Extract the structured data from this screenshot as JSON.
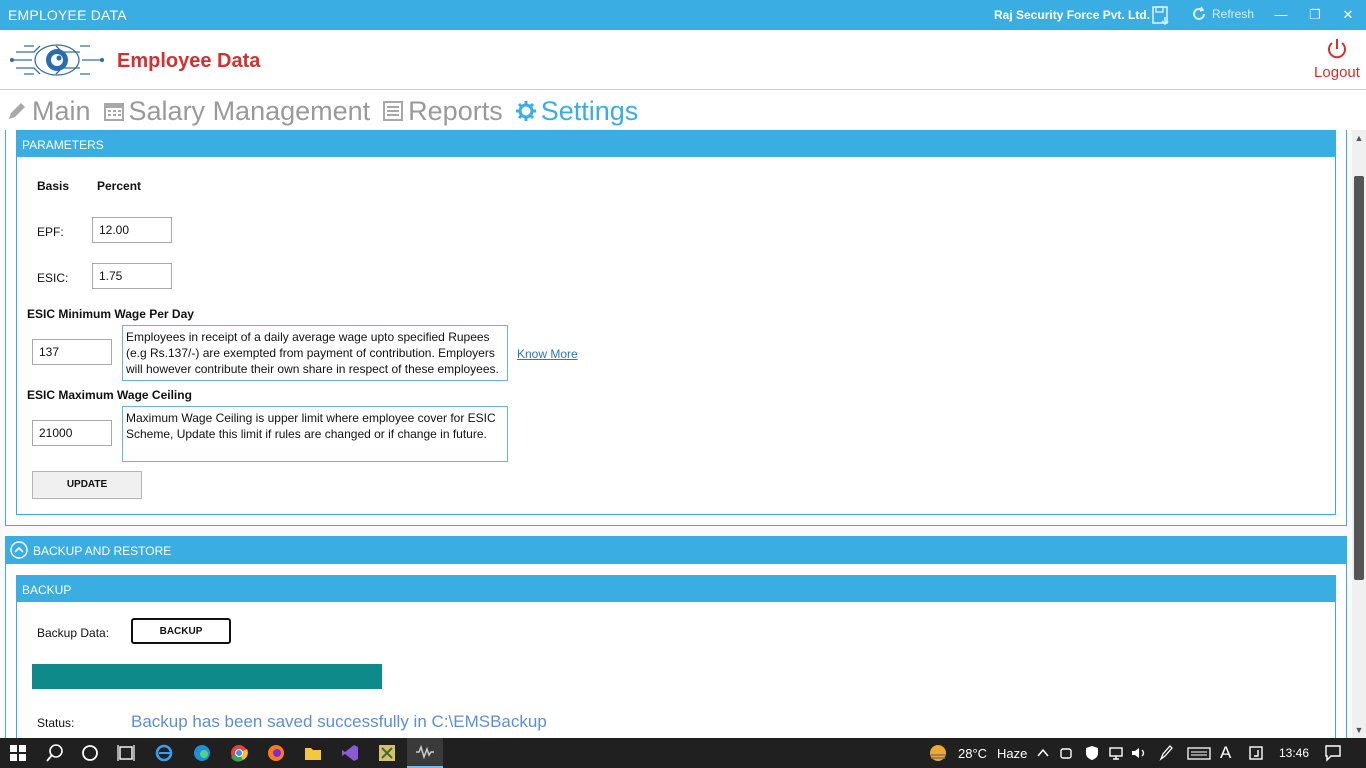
{
  "window": {
    "title": "EMPLOYEE DATA",
    "company": "Raj Security Force Pvt. Ltd.",
    "refresh_label": "Refresh",
    "minimize": "—",
    "restore": "❐",
    "close": "✕"
  },
  "header": {
    "title": "Employee Data",
    "logout_label": "Logout"
  },
  "tabs": [
    {
      "label": "Main",
      "icon": "pencil-icon",
      "active": false
    },
    {
      "label": "Salary Management",
      "icon": "calendar-icon",
      "active": false
    },
    {
      "label": "Reports",
      "icon": "list-icon",
      "active": false
    },
    {
      "label": "Settings",
      "icon": "gear-icon",
      "active": true
    }
  ],
  "parameters": {
    "title": "PARAMETERS",
    "basis_header": "Basis",
    "percent_header": "Percent",
    "epf_label": "EPF:",
    "epf_value": "12.00",
    "esic_label": "ESIC:",
    "esic_value": "1.75",
    "esic_min_title": "ESIC Minimum Wage Per Day",
    "esic_min_value": "137",
    "esic_min_note": "Employees in receipt of a daily average wage upto specified Rupees (e.g Rs.137/-) are exempted from payment of contribution. Employers will however contribute their own share in respect of these employees.",
    "know_more": "Know More",
    "esic_max_title": "ESIC Maximum Wage Ceiling",
    "esic_max_value": "21000",
    "esic_max_note": "Maximum Wage Ceiling is upper limit where employee cover for ESIC Scheme, Update this limit if rules are changed or if change in future.",
    "update_label": "UPDATE"
  },
  "backup_restore": {
    "title": "BACKUP AND RESTORE",
    "backup_title": "BACKUP",
    "backup_data_label": "Backup Data:",
    "backup_button": "BACKUP",
    "progress": 1.0,
    "status_label": "Status:",
    "status_text": "Backup has been saved successfully in C:\\EMSBackup"
  },
  "taskbar": {
    "temperature": "28°C",
    "weather": "Haze",
    "keyboard_lang": "A",
    "time": "13:46"
  },
  "colors": {
    "accent": "#3aaee2",
    "brand_red": "#d43030",
    "progress_fill": "#0f8a8a",
    "status_blue": "#5b8fd6"
  }
}
